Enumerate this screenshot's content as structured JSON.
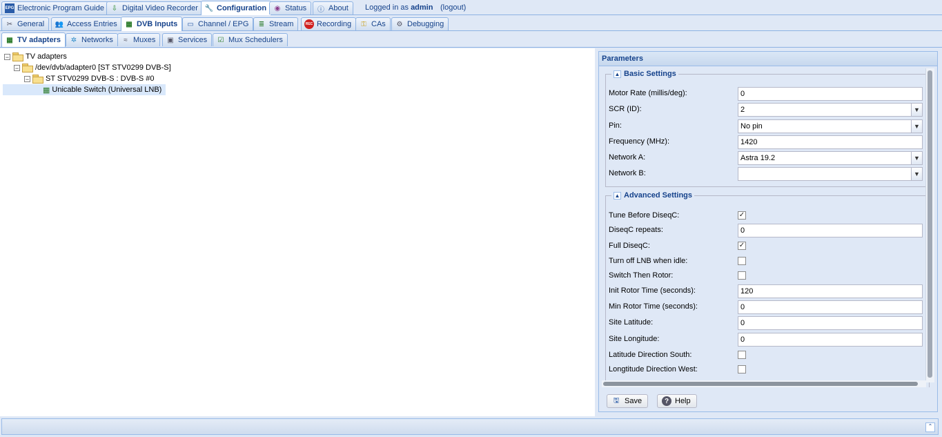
{
  "top_tabs": [
    {
      "label": "Electronic Program Guide",
      "icon": "epg-icon"
    },
    {
      "label": "Digital Video Recorder",
      "icon": "dvr-icon"
    },
    {
      "label": "Configuration",
      "icon": "wrench-icon"
    },
    {
      "label": "Status",
      "icon": "eye-icon"
    },
    {
      "label": "About",
      "icon": "info-icon"
    }
  ],
  "login": {
    "prefix": "Logged in as",
    "user": "admin",
    "logout": "(logout)"
  },
  "config_tabs": [
    {
      "label": "General",
      "icon": "tools-icon"
    },
    {
      "label": "Access Entries",
      "icon": "users-icon"
    },
    {
      "label": "DVB Inputs",
      "icon": "card-icon"
    },
    {
      "label": "Channel / EPG",
      "icon": "tv-icon"
    },
    {
      "label": "Stream",
      "icon": "stream-icon"
    },
    {
      "label": "Recording",
      "icon": "rec-icon"
    },
    {
      "label": "CAs",
      "icon": "key-icon"
    },
    {
      "label": "Debugging",
      "icon": "gears-icon"
    }
  ],
  "dvb_tabs": [
    {
      "label": "TV adapters",
      "icon": "adapter-icon"
    },
    {
      "label": "Networks",
      "icon": "antenna-icon"
    },
    {
      "label": "Muxes",
      "icon": "muxes-icon"
    },
    {
      "label": "Services",
      "icon": "services-icon"
    },
    {
      "label": "Mux Schedulers",
      "icon": "scheduler-icon"
    }
  ],
  "tree": {
    "root": "TV adapters",
    "adapter": "/dev/dvb/adapter0 [ST STV0299 DVB-S]",
    "frontend": "ST STV0299 DVB-S : DVB-S #0",
    "lnb": "Unicable Switch (Universal LNB)"
  },
  "params": {
    "title": "Parameters",
    "basic": {
      "legend": "Basic Settings",
      "motor_rate": {
        "label": "Motor Rate (millis/deg):",
        "value": "0"
      },
      "scr": {
        "label": "SCR (ID):",
        "value": "2"
      },
      "pin": {
        "label": "Pin:",
        "value": "No pin"
      },
      "frequency": {
        "label": "Frequency (MHz):",
        "value": "1420"
      },
      "network_a": {
        "label": "Network A:",
        "value": "Astra 19.2"
      },
      "network_b": {
        "label": "Network B:",
        "value": ""
      }
    },
    "advanced": {
      "legend": "Advanced Settings",
      "tune_before": {
        "label": "Tune Before DiseqC:",
        "checked": true
      },
      "diseqc_repeats": {
        "label": "DiseqC repeats:",
        "value": "0"
      },
      "full_diseqc": {
        "label": "Full DiseqC:",
        "checked": true
      },
      "turn_off_lnb": {
        "label": "Turn off LNB when idle:",
        "checked": false
      },
      "switch_then_rotor": {
        "label": "Switch Then Rotor:",
        "checked": false
      },
      "init_rotor": {
        "label": "Init Rotor Time (seconds):",
        "value": "120"
      },
      "min_rotor": {
        "label": "Min Rotor Time (seconds):",
        "value": "0"
      },
      "site_lat": {
        "label": "Site Latitude:",
        "value": "0"
      },
      "site_lon": {
        "label": "Site Longitude:",
        "value": "0"
      },
      "lat_south": {
        "label": "Latitude Direction South:",
        "checked": false
      },
      "lon_west": {
        "label": "Longtitude Direction West:",
        "checked": false
      }
    },
    "save_label": "Save",
    "help_label": "Help"
  }
}
